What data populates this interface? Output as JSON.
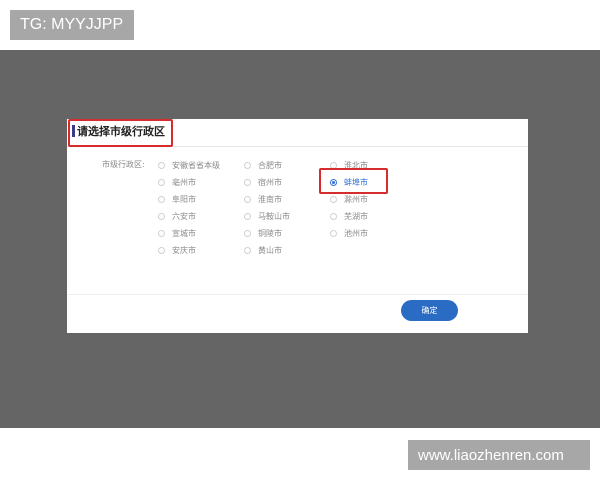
{
  "watermark_top": "TG: MYYJJPP",
  "watermark_bottom": "www.liaozhenren.com",
  "dialog": {
    "title": "请选择市级行政区",
    "field_label": "市级行政区:",
    "options": [
      {
        "label": "安徽省省本级",
        "checked": false
      },
      {
        "label": "合肥市",
        "checked": false
      },
      {
        "label": "淮北市",
        "checked": false
      },
      {
        "label": "亳州市",
        "checked": false
      },
      {
        "label": "宿州市",
        "checked": false
      },
      {
        "label": "蚌埠市",
        "checked": true
      },
      {
        "label": "阜阳市",
        "checked": false
      },
      {
        "label": "淮南市",
        "checked": false
      },
      {
        "label": "滁州市",
        "checked": false
      },
      {
        "label": "六安市",
        "checked": false
      },
      {
        "label": "马鞍山市",
        "checked": false
      },
      {
        "label": "芜湖市",
        "checked": false
      },
      {
        "label": "宣城市",
        "checked": false
      },
      {
        "label": "铜陵市",
        "checked": false
      },
      {
        "label": "池州市",
        "checked": false
      },
      {
        "label": "安庆市",
        "checked": false
      },
      {
        "label": "黄山市",
        "checked": false
      }
    ],
    "confirm_label": "确定"
  },
  "colors": {
    "backdrop": "#656565",
    "primary": "#2a6cc4",
    "highlight": "#d82c2c",
    "watermark_bg": "#a7a7a7"
  }
}
